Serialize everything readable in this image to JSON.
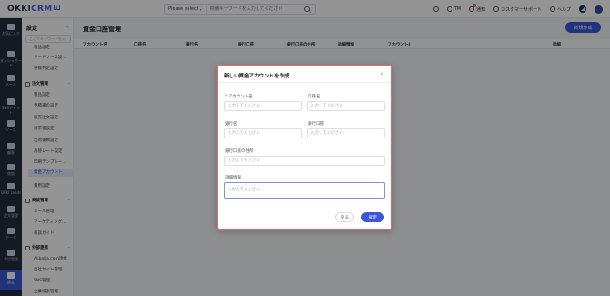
{
  "app": {
    "logo_text": "OKKI",
    "logo_crm": "CRM",
    "logo_mark": "β"
  },
  "topbar": {
    "search_select": "Please select",
    "search_placeholder": "検索キーワードを入力してください",
    "user_initials": "TM",
    "notice_label": "通知",
    "notice_count": "9",
    "support_label": "カスタマーサポート",
    "help_label": "ヘルプ"
  },
  "rail": [
    {
      "label": "お気に入り",
      "icon": "star-icon"
    },
    {
      "label": "ダッシュボード",
      "icon": "dashboard-icon"
    },
    {
      "label": "メール",
      "icon": "mail-icon"
    },
    {
      "label": "SNSチャット",
      "icon": "chat-icon"
    },
    {
      "label": "ソース",
      "icon": "source-icon"
    },
    {
      "label": "顧客",
      "icon": "customer-icon"
    },
    {
      "label": "商談",
      "icon": "deal-icon"
    },
    {
      "label": "OKKI Leads",
      "icon": "leads-icon"
    },
    {
      "label": "注文管理",
      "icon": "order-icon"
    },
    {
      "label": "データ",
      "icon": "data-icon"
    },
    {
      "label": "承認管理",
      "icon": "approval-icon"
    },
    {
      "label": "設定",
      "icon": "settings-icon"
    }
  ],
  "sidebar": {
    "title": "設定",
    "collapse": "«",
    "search_placeholder": "ここでキーワードを入",
    "items_top": [
      "製品設定",
      "リードソース設...",
      "重複判定設定"
    ],
    "group_order": "注文管理",
    "items_order": [
      "製品設定",
      "見積書の設定",
      "販売注文設定",
      "請求書設定",
      "出荷書類設定",
      "為替レート設定",
      "印刷テンプレー...",
      "資金アカウント",
      "費用設定"
    ],
    "group_deal": "商談管理",
    "items_deal": [
      "メール管理",
      "マーケティング...",
      "商談ガイド"
    ],
    "group_external": "外部連携",
    "items_external": [
      "Alibaba.com連携",
      "自社サイト管理",
      "SNS管理",
      "企業検索管理"
    ]
  },
  "main": {
    "title": "資金口座管理",
    "new_button": "新規作成",
    "columns": [
      "アカウント名",
      "口座名",
      "銀行名",
      "銀行口座",
      "銀行口座の住所",
      "詳細情報",
      "アカウントI",
      "詳細"
    ]
  },
  "modal": {
    "title": "新しい資金アカウントを作成",
    "close": "×",
    "required_mark": "*",
    "fields": {
      "account_name": {
        "label": "アカウント名",
        "placeholder": "入力してください"
      },
      "account_title": {
        "label": "口座名",
        "placeholder": "入力してください"
      },
      "bank_name": {
        "label": "銀行名",
        "placeholder": "入力してください"
      },
      "bank_account": {
        "label": "銀行口座",
        "placeholder": "入力してください"
      },
      "bank_address": {
        "label": "銀行口座の住所",
        "placeholder": "入力してください"
      },
      "details": {
        "label": "詳細情報",
        "placeholder": "入力してください"
      }
    },
    "back_button": "戻る",
    "ok_button": "確定"
  },
  "colors": {
    "accent": "#3d57d6",
    "rail_bg": "#232c3d",
    "overlay": "rgba(0,0,0,0.42)"
  }
}
